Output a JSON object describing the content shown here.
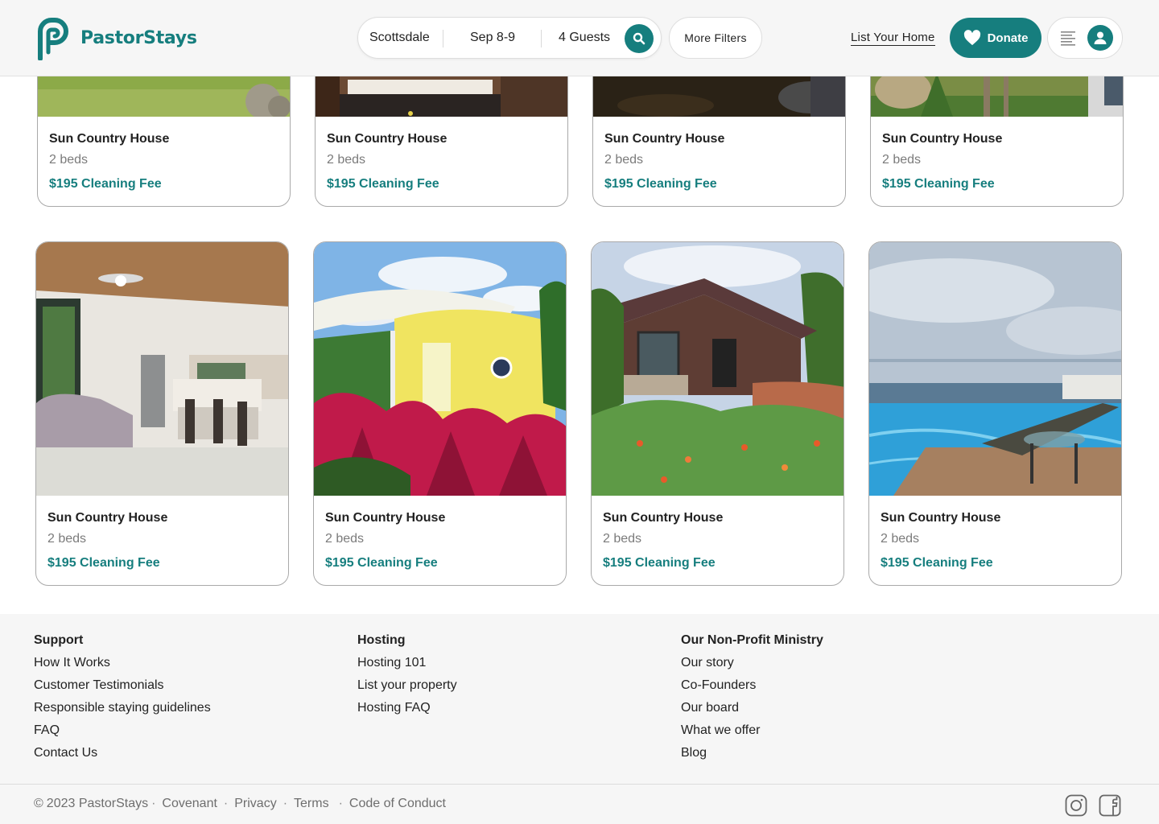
{
  "brand": {
    "name": "PastorStays",
    "color": "#167e7e"
  },
  "search": {
    "location": "Scottsdale",
    "dates": "Sep 8-9",
    "guests": "4 Guests",
    "icon": "search-icon"
  },
  "header": {
    "more_filters": "More Filters",
    "list_home": "List Your Home",
    "donate": "Donate"
  },
  "listings": [
    {
      "title": "Sun Country House",
      "beds": "2 beds",
      "fee": "$195 Cleaning Fee",
      "scene": "garden lawn"
    },
    {
      "title": "Sun Country House",
      "beds": "2 beds",
      "fee": "$195 Cleaning Fee",
      "scene": "bedroom"
    },
    {
      "title": "Sun Country House",
      "beds": "2 beds",
      "fee": "$195 Cleaning Fee",
      "scene": "dark garden"
    },
    {
      "title": "Sun Country House",
      "beds": "2 beds",
      "fee": "$195 Cleaning Fee",
      "scene": "garden"
    },
    {
      "title": "Sun Country House",
      "beds": "2 beds",
      "fee": "$195 Cleaning Fee",
      "scene": "kitchen living room"
    },
    {
      "title": "Sun Country House",
      "beds": "2 beds",
      "fee": "$195 Cleaning Fee",
      "scene": "yellow round house"
    },
    {
      "title": "Sun Country House",
      "beds": "2 beds",
      "fee": "$195 Cleaning Fee",
      "scene": "wooden cabin"
    },
    {
      "title": "Sun Country House",
      "beds": "2 beds",
      "fee": "$195 Cleaning Fee",
      "scene": "infinity pool ocean view"
    }
  ],
  "footer": {
    "support": {
      "heading": "Support",
      "links": [
        "How It Works",
        "Customer Testimonials",
        "Responsible staying guidelines",
        "FAQ",
        "Contact Us"
      ]
    },
    "hosting": {
      "heading": "Hosting",
      "links": [
        "Hosting 101",
        "List your property",
        "Hosting FAQ"
      ]
    },
    "ministry": {
      "heading": "Our Non-Profit Ministry",
      "links": [
        "Our story",
        "Co-Founders",
        "Our board",
        "What we offer",
        "Blog"
      ]
    },
    "copyright": "2023 PastorStays",
    "legal": [
      "Covenant",
      "Privacy",
      "Terms",
      "Code of Conduct"
    ],
    "social": [
      "instagram-icon",
      "facebook-icon"
    ]
  }
}
